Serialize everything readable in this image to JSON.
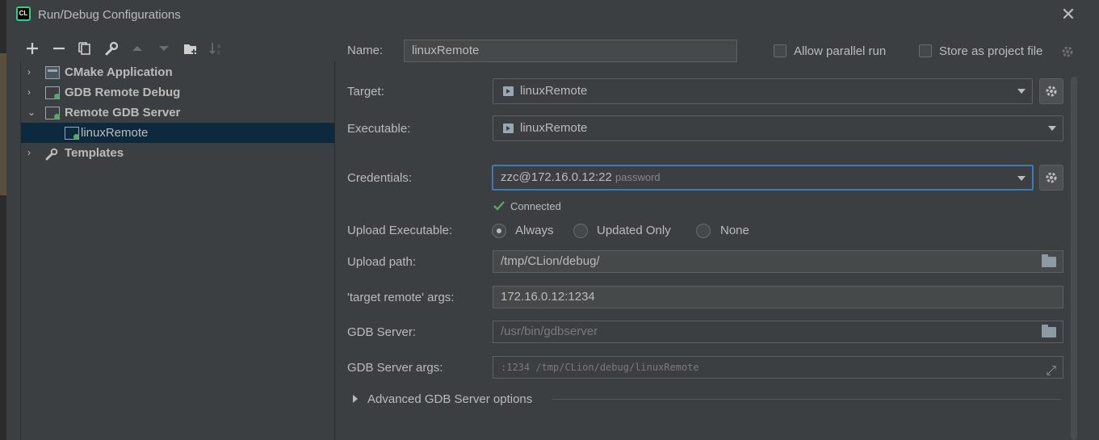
{
  "window": {
    "title": "Run/Debug Configurations",
    "close_glyph": "✕"
  },
  "toolbar": {
    "add": "+",
    "remove": "−",
    "copy": "⧉",
    "edit": "🔧",
    "up": "▲",
    "down": "▼",
    "folder": "📁",
    "sort": "↓ᵃᶻ"
  },
  "tree": {
    "items": [
      {
        "label": "CMake Application",
        "expanded": false
      },
      {
        "label": "GDB Remote Debug",
        "expanded": false
      },
      {
        "label": "Remote GDB Server",
        "expanded": true
      },
      {
        "label": "linuxRemote",
        "selected": true
      },
      {
        "label": "Templates",
        "expanded": false
      }
    ]
  },
  "form": {
    "name_label": "Name:",
    "name_value": "linuxRemote",
    "allow_parallel_label": "Allow parallel run",
    "store_project_label": "Store as project file",
    "target_label": "Target:",
    "target_value": "linuxRemote",
    "executable_label": "Executable:",
    "executable_value": "linuxRemote",
    "credentials_label": "Credentials:",
    "credentials_value": "zzc@172.16.0.12:22",
    "credentials_hint": "password",
    "status_text": "Connected",
    "upload_exec_label": "Upload Executable:",
    "upload_options": [
      "Always",
      "Updated Only",
      "None"
    ],
    "upload_selected": "Always",
    "upload_path_label": "Upload path:",
    "upload_path_value": "/tmp/CLion/debug/",
    "target_remote_label": "'target remote' args:",
    "target_remote_value": "172.16.0.12:1234",
    "gdb_server_label": "GDB Server:",
    "gdb_server_value": "/usr/bin/gdbserver",
    "gdb_server_args_label": "GDB Server args:",
    "gdb_server_args_value": ":1234 /tmp/CLion/debug/linuxRemote",
    "advanced_label": "Advanced GDB Server options"
  },
  "colors": {
    "background": "#3c3f41",
    "selection": "#0d293e",
    "focus": "#3d7ab3",
    "success": "#59a869"
  }
}
